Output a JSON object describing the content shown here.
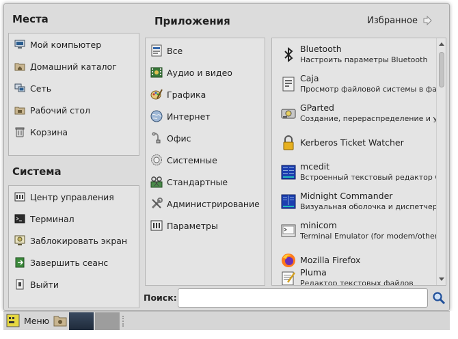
{
  "places": {
    "title": "Места",
    "items": [
      {
        "label": "Мой компьютер",
        "icon": "computer-icon"
      },
      {
        "label": "Домашний каталог",
        "icon": "home-folder-icon"
      },
      {
        "label": "Сеть",
        "icon": "network-icon"
      },
      {
        "label": "Рабочий стол",
        "icon": "desktop-folder-icon"
      },
      {
        "label": "Корзина",
        "icon": "trash-icon"
      }
    ]
  },
  "system": {
    "title": "Система",
    "items": [
      {
        "label": "Центр управления",
        "icon": "control-center-icon"
      },
      {
        "label": "Терминал",
        "icon": "terminal-icon"
      },
      {
        "label": "Заблокировать экран",
        "icon": "lock-screen-icon"
      },
      {
        "label": "Завершить сеанс",
        "icon": "logout-icon"
      },
      {
        "label": "Выйти",
        "icon": "shutdown-icon"
      }
    ]
  },
  "applications": {
    "title": "Приложения",
    "favorites_label": "Избранное",
    "categories": [
      {
        "label": "Все",
        "icon": "all-apps-icon"
      },
      {
        "label": "Аудио и видео",
        "icon": "multimedia-icon"
      },
      {
        "label": "Графика",
        "icon": "graphics-icon"
      },
      {
        "label": "Интернет",
        "icon": "internet-icon"
      },
      {
        "label": "Офис",
        "icon": "office-icon"
      },
      {
        "label": "Системные",
        "icon": "system-tools-icon"
      },
      {
        "label": "Стандартные",
        "icon": "accessories-icon"
      },
      {
        "label": "Администрирование",
        "icon": "administration-icon"
      },
      {
        "label": "Параметры",
        "icon": "preferences-icon"
      }
    ],
    "apps": [
      {
        "name": "Bluetooth",
        "desc": "Настроить параметры Bluetooth",
        "icon": "bluetooth-icon"
      },
      {
        "name": "Caja",
        "desc": "Просмотр файловой системы в файл…",
        "icon": "caja-icon"
      },
      {
        "name": "GParted",
        "desc": "Создание, перераспределение и уд…",
        "icon": "gparted-icon"
      },
      {
        "name": "Kerberos Ticket Watcher",
        "desc": "",
        "icon": "kerberos-lock-icon"
      },
      {
        "name": "mcedit",
        "desc": "Встроенный текстовый редактор G…",
        "icon": "mcedit-icon"
      },
      {
        "name": "Midnight Commander",
        "desc": "Визуальная оболочка и диспетчер …",
        "icon": "midnight-commander-icon"
      },
      {
        "name": "minicom",
        "desc": "Terminal Emulator (for modem/other …",
        "icon": "minicom-icon"
      },
      {
        "name": "Mozilla Firefox",
        "desc": "",
        "icon": "firefox-icon"
      },
      {
        "name": "Pluma",
        "desc": "Редактор текстовых файлов",
        "icon": "pluma-icon"
      }
    ]
  },
  "search": {
    "label": "Поиск:",
    "value": "",
    "placeholder": ""
  },
  "taskbar": {
    "menu_label": "Меню"
  }
}
